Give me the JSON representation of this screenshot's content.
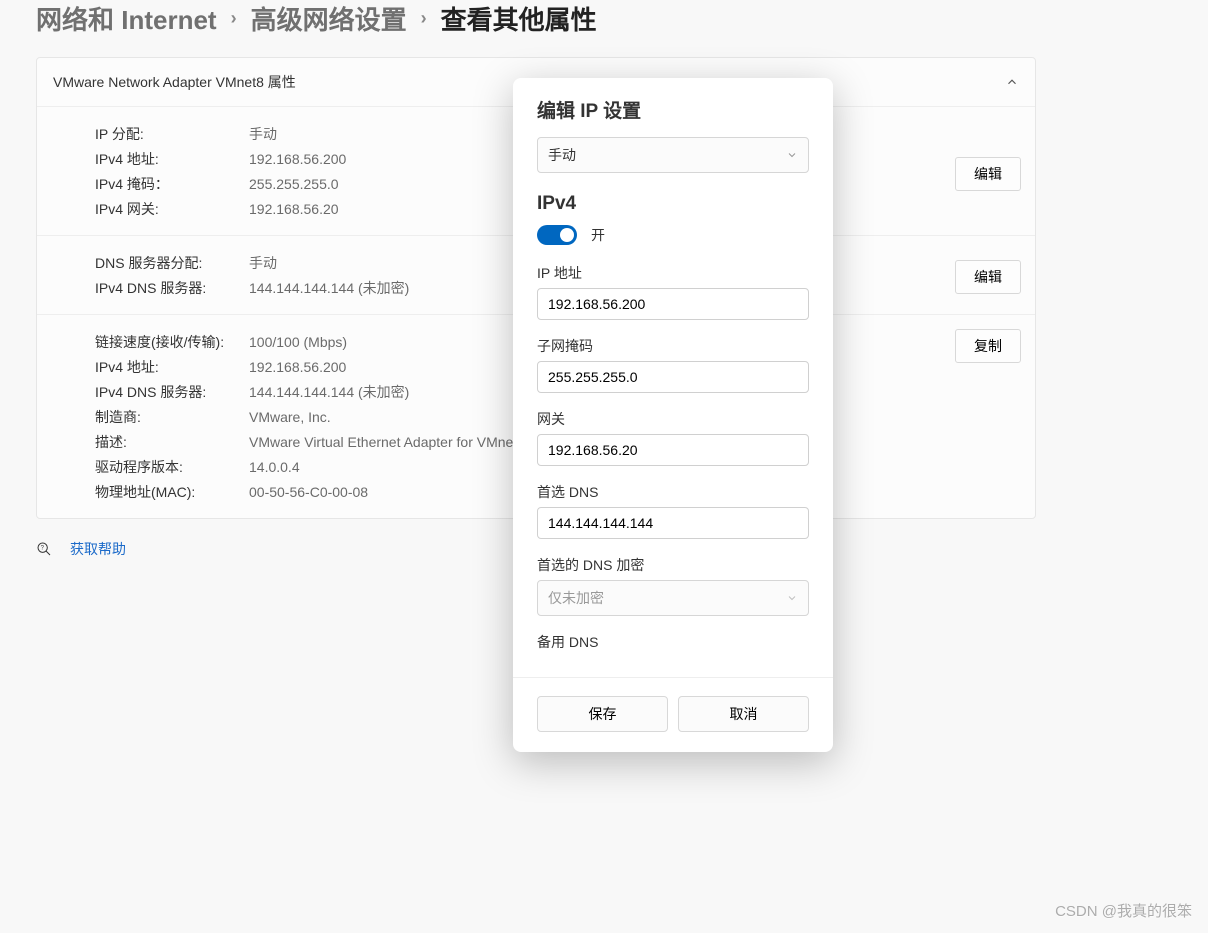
{
  "breadcrumb": {
    "prev1": "网络和 Internet",
    "prev2": "高级网络设置",
    "current": "查看其他属性"
  },
  "panel": {
    "title": "VMware Network Adapter VMnet8 属性"
  },
  "ip_section": {
    "rows": [
      {
        "label": "IP 分配:",
        "value": "手动"
      },
      {
        "label": "IPv4 地址:",
        "value": "192.168.56.200"
      },
      {
        "label": "IPv4 掩码：",
        "value": "255.255.255.0"
      },
      {
        "label": "IPv4 网关:",
        "value": "192.168.56.20"
      }
    ],
    "button": "编辑"
  },
  "dns_section": {
    "rows": [
      {
        "label": "DNS 服务器分配:",
        "value": "手动"
      },
      {
        "label": "IPv4 DNS 服务器:",
        "value": "144.144.144.144 (未加密)"
      }
    ],
    "button": "编辑"
  },
  "info_section": {
    "rows": [
      {
        "label": "链接速度(接收/传输):",
        "value": "100/100 (Mbps)"
      },
      {
        "label": "IPv4 地址:",
        "value": "192.168.56.200"
      },
      {
        "label": "IPv4 DNS 服务器:",
        "value": "144.144.144.144 (未加密)"
      },
      {
        "label": "制造商:",
        "value": "VMware, Inc."
      },
      {
        "label": "描述:",
        "value": "VMware Virtual Ethernet Adapter for VMne"
      },
      {
        "label": "驱动程序版本:",
        "value": "14.0.0.4"
      },
      {
        "label": "物理地址(MAC):",
        "value": "00-50-56-C0-00-08"
      }
    ],
    "button": "复制"
  },
  "help_link": "获取帮助",
  "modal": {
    "title": "编辑 IP 设置",
    "mode_select": "手动",
    "ipv4_heading": "IPv4",
    "toggle_label": "开",
    "fields": {
      "ip_label": "IP 地址",
      "ip_value": "192.168.56.200",
      "mask_label": "子网掩码",
      "mask_value": "255.255.255.0",
      "gw_label": "网关",
      "gw_value": "192.168.56.20",
      "dns1_label": "首选 DNS",
      "dns1_value": "144.144.144.144",
      "enc_label": "首选的 DNS 加密",
      "enc_value": "仅未加密",
      "dns2_label": "备用 DNS"
    },
    "save": "保存",
    "cancel": "取消"
  },
  "watermark": "CSDN @我真的很笨"
}
